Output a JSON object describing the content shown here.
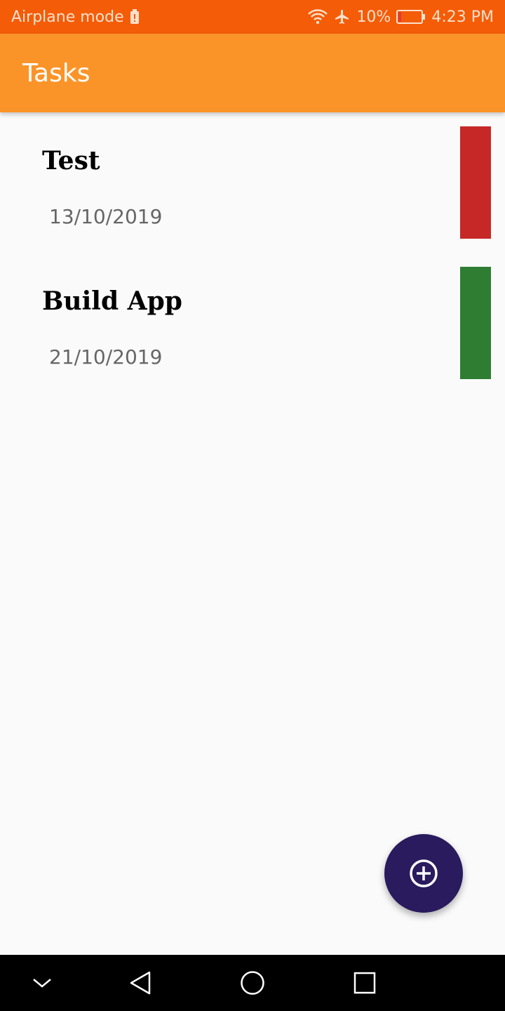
{
  "status_bar": {
    "left_text": "Airplane mode",
    "battery_percent": "10%",
    "time": "4:23 PM",
    "icons": [
      "alert-battery-icon",
      "wifi-icon",
      "airplane-icon",
      "battery-icon"
    ],
    "color": "#f45c08"
  },
  "app_bar": {
    "title": "Tasks",
    "color": "#fb9428"
  },
  "tasks": [
    {
      "title": "Test",
      "date": "13/10/2019",
      "priority_color": "#c62828"
    },
    {
      "title": "Build App",
      "date": "21/10/2019",
      "priority_color": "#2e7d32"
    }
  ],
  "fab": {
    "icon": "add-circle-icon",
    "color": "#2a1a5e"
  },
  "nav_bar": {
    "buttons": [
      "collapse-icon",
      "back-icon",
      "home-icon",
      "recents-icon"
    ]
  }
}
